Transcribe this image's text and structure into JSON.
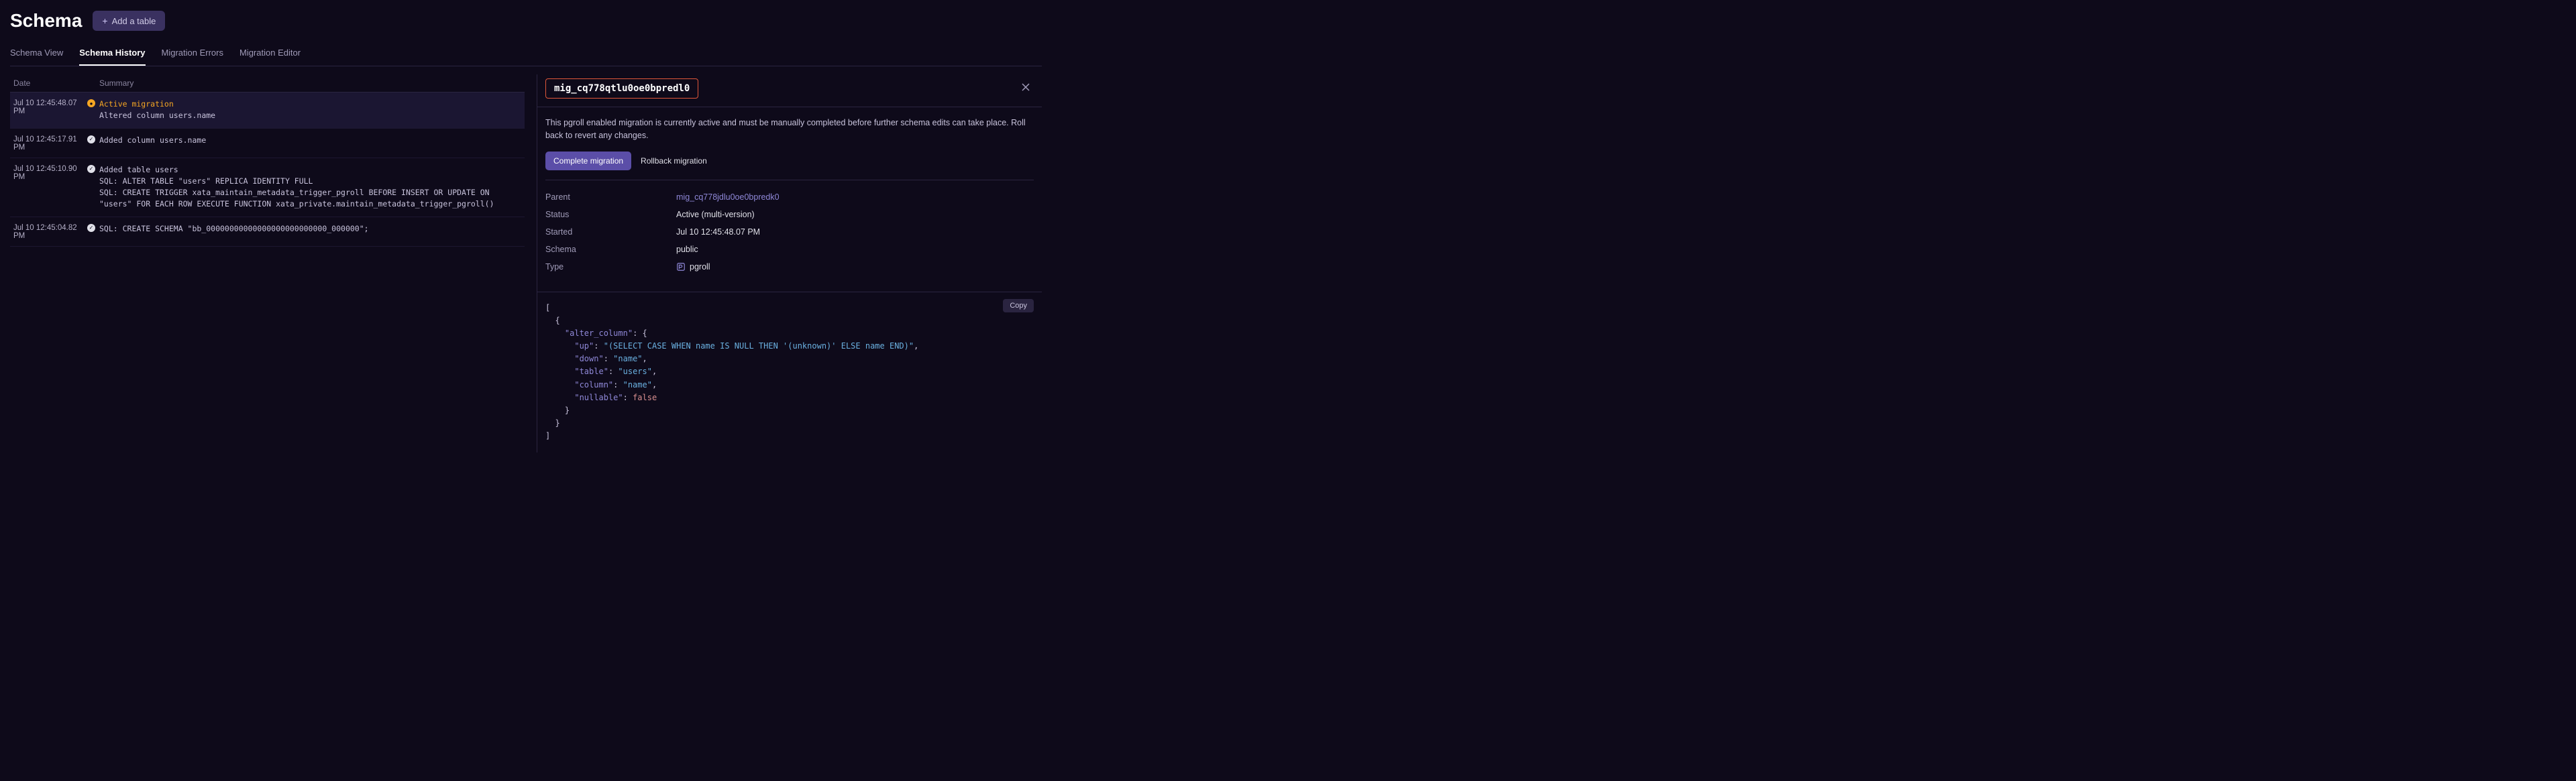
{
  "header": {
    "title": "Schema",
    "add_table_label": "Add a table"
  },
  "tabs": [
    {
      "label": "Schema View",
      "active": false
    },
    {
      "label": "Schema History",
      "active": true
    },
    {
      "label": "Migration Errors",
      "active": false
    },
    {
      "label": "Migration Editor",
      "active": false
    }
  ],
  "history": {
    "columns": {
      "date": "Date",
      "summary": "Summary"
    },
    "rows": [
      {
        "date": "Jul 10 12:45:48.07 PM",
        "status": "active",
        "summary_lines": [
          "Active migration",
          "Altered column users.name"
        ],
        "selected": true
      },
      {
        "date": "Jul 10 12:45:17.91 PM",
        "status": "done",
        "summary_lines": [
          "Added column users.name"
        ],
        "selected": false
      },
      {
        "date": "Jul 10 12:45:10.90 PM",
        "status": "done",
        "summary_lines": [
          "Added table users",
          "SQL: ALTER TABLE \"users\" REPLICA IDENTITY FULL",
          "SQL: CREATE TRIGGER xata_maintain_metadata_trigger_pgroll BEFORE INSERT OR UPDATE ON \"users\" FOR EACH ROW EXECUTE FUNCTION xata_private.maintain_metadata_trigger_pgroll()"
        ],
        "selected": false
      },
      {
        "date": "Jul 10 12:45:04.82 PM",
        "status": "done",
        "summary_lines": [
          "SQL: CREATE SCHEMA \"bb_00000000000000000000000000_000000\";"
        ],
        "selected": false
      }
    ]
  },
  "detail": {
    "migration_id": "mig_cq778qtlu0oe0bpredl0",
    "notice": "This pgroll enabled migration is currently active and must be manually completed before further schema edits can take place. Roll back to revert any changes.",
    "complete_label": "Complete migration",
    "rollback_label": "Rollback migration",
    "fields": {
      "parent_label": "Parent",
      "parent_value": "mig_cq778jdlu0oe0bpredk0",
      "status_label": "Status",
      "status_value": "Active (multi-version)",
      "started_label": "Started",
      "started_value": "Jul 10 12:45:48.07 PM",
      "schema_label": "Schema",
      "schema_value": "public",
      "type_label": "Type",
      "type_value": "pgroll"
    },
    "copy_label": "Copy",
    "code_json": [
      {
        "alter_column": {
          "up": "(SELECT CASE WHEN name IS NULL THEN '(unknown)' ELSE name END)",
          "down": "name",
          "table": "users",
          "column": "name",
          "nullable": false
        }
      }
    ]
  }
}
